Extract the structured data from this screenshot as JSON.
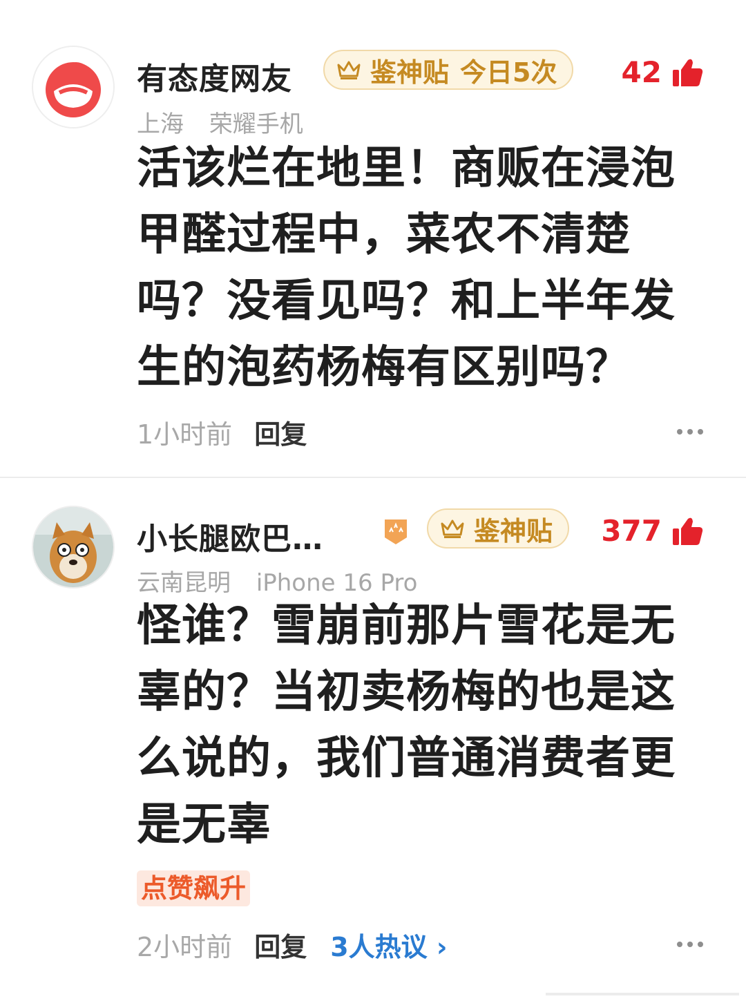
{
  "comments": [
    {
      "username": "有态度网友",
      "badge": "鉴神贴",
      "badge_extra": "今日5次",
      "likes": "42",
      "location": "上海",
      "device": "荣耀手机",
      "text": "活该烂在地里！商贩在浸泡甲醛过程中，菜农不清楚吗？没看见吗？和上半年发生的泡药杨梅有区别吗？",
      "time": "1小时前",
      "reply_label": "回复"
    },
    {
      "username": "小长腿欧巴…",
      "badge": "鉴神贴",
      "likes": "377",
      "location": "云南昆明",
      "device": "iPhone 16 Pro",
      "text": "怪谁？雪崩前那片雪花是无辜的？当初卖杨梅的也是这么说的，我们普通消费者更是无辜",
      "tag": "点赞飙升",
      "time": "2小时前",
      "reply_label": "回复",
      "hot_discussion": "3人热议 ›"
    }
  ],
  "colors": {
    "like_red": "#e4222b",
    "badge_gold": "#c58a22",
    "link_blue": "#2a7bd1",
    "tag_orange": "#ec5a2a"
  },
  "icons": [
    "netease-logo-icon",
    "shiba-avatar",
    "crown-icon",
    "thumbs-up-icon",
    "rank-badge-icon",
    "more-dots-icon"
  ]
}
